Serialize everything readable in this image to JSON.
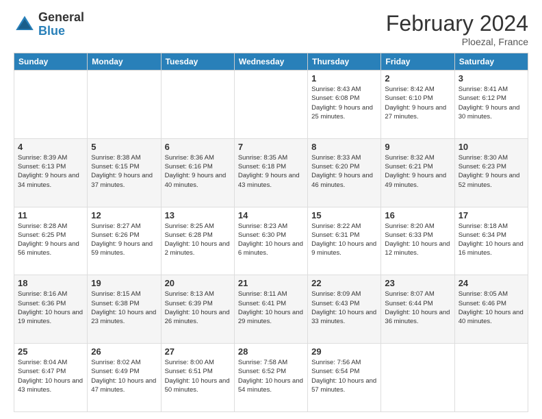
{
  "logo": {
    "general": "General",
    "blue": "Blue"
  },
  "title": "February 2024",
  "subtitle": "Ploezal, France",
  "headers": [
    "Sunday",
    "Monday",
    "Tuesday",
    "Wednesday",
    "Thursday",
    "Friday",
    "Saturday"
  ],
  "weeks": [
    [
      {
        "day": "",
        "info": ""
      },
      {
        "day": "",
        "info": ""
      },
      {
        "day": "",
        "info": ""
      },
      {
        "day": "",
        "info": ""
      },
      {
        "day": "1",
        "info": "Sunrise: 8:43 AM\nSunset: 6:08 PM\nDaylight: 9 hours and 25 minutes."
      },
      {
        "day": "2",
        "info": "Sunrise: 8:42 AM\nSunset: 6:10 PM\nDaylight: 9 hours and 27 minutes."
      },
      {
        "day": "3",
        "info": "Sunrise: 8:41 AM\nSunset: 6:12 PM\nDaylight: 9 hours and 30 minutes."
      }
    ],
    [
      {
        "day": "4",
        "info": "Sunrise: 8:39 AM\nSunset: 6:13 PM\nDaylight: 9 hours and 34 minutes."
      },
      {
        "day": "5",
        "info": "Sunrise: 8:38 AM\nSunset: 6:15 PM\nDaylight: 9 hours and 37 minutes."
      },
      {
        "day": "6",
        "info": "Sunrise: 8:36 AM\nSunset: 6:16 PM\nDaylight: 9 hours and 40 minutes."
      },
      {
        "day": "7",
        "info": "Sunrise: 8:35 AM\nSunset: 6:18 PM\nDaylight: 9 hours and 43 minutes."
      },
      {
        "day": "8",
        "info": "Sunrise: 8:33 AM\nSunset: 6:20 PM\nDaylight: 9 hours and 46 minutes."
      },
      {
        "day": "9",
        "info": "Sunrise: 8:32 AM\nSunset: 6:21 PM\nDaylight: 9 hours and 49 minutes."
      },
      {
        "day": "10",
        "info": "Sunrise: 8:30 AM\nSunset: 6:23 PM\nDaylight: 9 hours and 52 minutes."
      }
    ],
    [
      {
        "day": "11",
        "info": "Sunrise: 8:28 AM\nSunset: 6:25 PM\nDaylight: 9 hours and 56 minutes."
      },
      {
        "day": "12",
        "info": "Sunrise: 8:27 AM\nSunset: 6:26 PM\nDaylight: 9 hours and 59 minutes."
      },
      {
        "day": "13",
        "info": "Sunrise: 8:25 AM\nSunset: 6:28 PM\nDaylight: 10 hours and 2 minutes."
      },
      {
        "day": "14",
        "info": "Sunrise: 8:23 AM\nSunset: 6:30 PM\nDaylight: 10 hours and 6 minutes."
      },
      {
        "day": "15",
        "info": "Sunrise: 8:22 AM\nSunset: 6:31 PM\nDaylight: 10 hours and 9 minutes."
      },
      {
        "day": "16",
        "info": "Sunrise: 8:20 AM\nSunset: 6:33 PM\nDaylight: 10 hours and 12 minutes."
      },
      {
        "day": "17",
        "info": "Sunrise: 8:18 AM\nSunset: 6:34 PM\nDaylight: 10 hours and 16 minutes."
      }
    ],
    [
      {
        "day": "18",
        "info": "Sunrise: 8:16 AM\nSunset: 6:36 PM\nDaylight: 10 hours and 19 minutes."
      },
      {
        "day": "19",
        "info": "Sunrise: 8:15 AM\nSunset: 6:38 PM\nDaylight: 10 hours and 23 minutes."
      },
      {
        "day": "20",
        "info": "Sunrise: 8:13 AM\nSunset: 6:39 PM\nDaylight: 10 hours and 26 minutes."
      },
      {
        "day": "21",
        "info": "Sunrise: 8:11 AM\nSunset: 6:41 PM\nDaylight: 10 hours and 29 minutes."
      },
      {
        "day": "22",
        "info": "Sunrise: 8:09 AM\nSunset: 6:43 PM\nDaylight: 10 hours and 33 minutes."
      },
      {
        "day": "23",
        "info": "Sunrise: 8:07 AM\nSunset: 6:44 PM\nDaylight: 10 hours and 36 minutes."
      },
      {
        "day": "24",
        "info": "Sunrise: 8:05 AM\nSunset: 6:46 PM\nDaylight: 10 hours and 40 minutes."
      }
    ],
    [
      {
        "day": "25",
        "info": "Sunrise: 8:04 AM\nSunset: 6:47 PM\nDaylight: 10 hours and 43 minutes."
      },
      {
        "day": "26",
        "info": "Sunrise: 8:02 AM\nSunset: 6:49 PM\nDaylight: 10 hours and 47 minutes."
      },
      {
        "day": "27",
        "info": "Sunrise: 8:00 AM\nSunset: 6:51 PM\nDaylight: 10 hours and 50 minutes."
      },
      {
        "day": "28",
        "info": "Sunrise: 7:58 AM\nSunset: 6:52 PM\nDaylight: 10 hours and 54 minutes."
      },
      {
        "day": "29",
        "info": "Sunrise: 7:56 AM\nSunset: 6:54 PM\nDaylight: 10 hours and 57 minutes."
      },
      {
        "day": "",
        "info": ""
      },
      {
        "day": "",
        "info": ""
      }
    ]
  ]
}
